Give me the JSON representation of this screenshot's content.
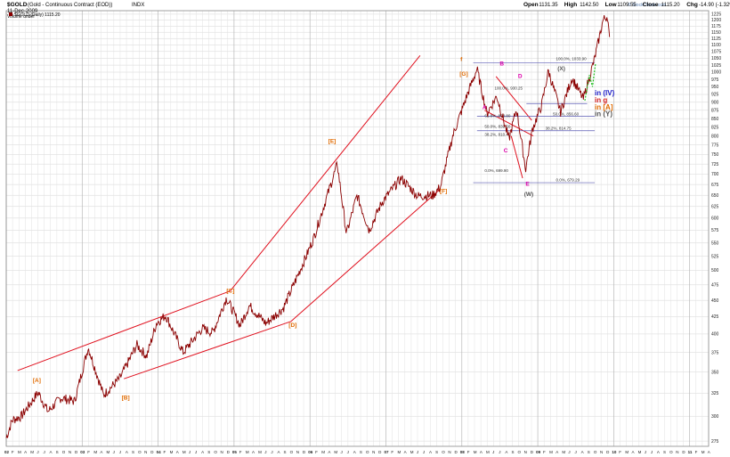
{
  "header": {
    "symbol": "$GOLD",
    "name": "(Gold - Continuous Contract (EOD))",
    "exchange": "INDX",
    "date": "11-Dec-2009",
    "volume": "Volume undef",
    "legend_name": "$GOLD (Daily)",
    "legend_value": "1115.20",
    "watermark": "© StockCharts.com",
    "ohlc": [
      {
        "label": "Open",
        "value": "1131.35"
      },
      {
        "label": "High",
        "value": "1142.50"
      },
      {
        "label": "Low",
        "value": "1109.55"
      },
      {
        "label": "Close",
        "value": "1115.20"
      },
      {
        "label": "Chg",
        "value": "-14.90 (-1.32%)"
      }
    ]
  },
  "chart_data": {
    "type": "line",
    "title": "$GOLD (Daily) 1115.20",
    "y_scale": "log",
    "ylim": [
      270,
      1240
    ],
    "xlim": [
      "2002-01",
      "2011-03"
    ],
    "grid": true,
    "y_ticks": [
      275,
      300,
      325,
      350,
      375,
      400,
      425,
      450,
      475,
      500,
      525,
      550,
      575,
      600,
      625,
      650,
      675,
      700,
      725,
      750,
      775,
      800,
      825,
      850,
      875,
      900,
      925,
      950,
      975,
      1000,
      1025,
      1050,
      1075,
      1100,
      1125,
      1150,
      1175,
      1200,
      1225
    ],
    "x_years": [
      {
        "label": "02",
        "t": 2002.0
      },
      {
        "label": "03",
        "t": 2003.0
      },
      {
        "label": "04",
        "t": 2004.0
      },
      {
        "label": "05",
        "t": 2005.0
      },
      {
        "label": "06",
        "t": 2006.0
      },
      {
        "label": "07",
        "t": 2007.0
      },
      {
        "label": "08",
        "t": 2008.0
      },
      {
        "label": "09",
        "t": 2009.0
      },
      {
        "label": "10",
        "t": 2010.0
      },
      {
        "label": "11",
        "t": 2011.0
      }
    ],
    "x_month_letters": [
      "J",
      "F",
      "M",
      "A",
      "M",
      "J",
      "J",
      "A",
      "S",
      "O",
      "N",
      "D"
    ],
    "series": [
      {
        "color": "#8b0000",
        "points": [
          [
            2002.0,
            278
          ],
          [
            2002.08,
            296
          ],
          [
            2002.2,
            300
          ],
          [
            2002.42,
            326
          ],
          [
            2002.55,
            305
          ],
          [
            2002.72,
            320
          ],
          [
            2002.9,
            316
          ],
          [
            2003.08,
            382
          ],
          [
            2003.28,
            323
          ],
          [
            2003.5,
            343
          ],
          [
            2003.72,
            385
          ],
          [
            2003.85,
            370
          ],
          [
            2003.98,
            416
          ],
          [
            2004.1,
            427
          ],
          [
            2004.33,
            375
          ],
          [
            2004.58,
            408
          ],
          [
            2004.72,
            402
          ],
          [
            2004.9,
            454
          ],
          [
            2005.08,
            412
          ],
          [
            2005.2,
            442
          ],
          [
            2005.42,
            415
          ],
          [
            2005.65,
            438
          ],
          [
            2005.95,
            525
          ],
          [
            2006.05,
            560
          ],
          [
            2006.36,
            725
          ],
          [
            2006.48,
            568
          ],
          [
            2006.62,
            650
          ],
          [
            2006.78,
            575
          ],
          [
            2006.95,
            635
          ],
          [
            2007.2,
            690
          ],
          [
            2007.42,
            648
          ],
          [
            2007.62,
            650
          ],
          [
            2007.72,
            670
          ],
          [
            2007.88,
            800
          ],
          [
            2008.08,
            930
          ],
          [
            2008.2,
            1011
          ],
          [
            2008.33,
            865
          ],
          [
            2008.46,
            920
          ],
          [
            2008.62,
            790
          ],
          [
            2008.72,
            880
          ],
          [
            2008.84,
            712
          ],
          [
            2008.93,
            820
          ],
          [
            2009.05,
            890
          ],
          [
            2009.14,
            1005
          ],
          [
            2009.3,
            870
          ],
          [
            2009.45,
            980
          ],
          [
            2009.6,
            910
          ],
          [
            2009.75,
            1050
          ],
          [
            2009.86,
            1200
          ],
          [
            2009.92,
            1218
          ],
          [
            2009.945,
            1115
          ]
        ]
      }
    ],
    "annotations": [
      {
        "text": "[A]",
        "color": "#e06a00",
        "t": 2002.35,
        "v": 338
      },
      {
        "text": "[B]",
        "color": "#e06a00",
        "t": 2003.52,
        "v": 318
      },
      {
        "text": "[C]",
        "color": "#e06a00",
        "t": 2004.9,
        "v": 462
      },
      {
        "text": "[D]",
        "color": "#e06a00",
        "t": 2005.72,
        "v": 410
      },
      {
        "text": "[E]",
        "color": "#e06a00",
        "t": 2006.24,
        "v": 780
      },
      {
        "text": "[F]",
        "color": "#e06a00",
        "t": 2007.71,
        "v": 655
      },
      {
        "text": "f",
        "color": "#e06a00",
        "t": 2007.98,
        "v": 1040
      },
      {
        "text": "[G]",
        "color": "#e06a00",
        "t": 2007.97,
        "v": 988
      },
      {
        "text": "A",
        "color": "#dd00aa",
        "t": 2008.27,
        "v": 878
      },
      {
        "text": "B",
        "color": "#dd00aa",
        "t": 2008.5,
        "v": 1023
      },
      {
        "text": "C",
        "color": "#dd00aa",
        "t": 2008.55,
        "v": 755
      },
      {
        "text": "D",
        "color": "#dd00aa",
        "t": 2008.74,
        "v": 980
      },
      {
        "text": "E",
        "color": "#dd00aa",
        "t": 2008.84,
        "v": 672
      },
      {
        "text": "(W)",
        "color": "#555555",
        "t": 2008.82,
        "v": 648
      },
      {
        "text": "(X)",
        "color": "#555555",
        "t": 2009.26,
        "v": 1007
      },
      {
        "text": "in (IV)",
        "color": "#1e1ec8",
        "t": 2009.75,
        "v": 922
      },
      {
        "text": "in g",
        "color": "#d21e1e",
        "t": 2009.75,
        "v": 900
      },
      {
        "text": "in [A]",
        "color": "#e06a00",
        "t": 2009.75,
        "v": 877
      },
      {
        "text": "in (Y)",
        "color": "#555555",
        "t": 2009.75,
        "v": 857
      }
    ],
    "fib_labels": [
      {
        "text": "100.0%, 1033.90",
        "t": 2009.24,
        "v": 1043
      },
      {
        "text": "0.0%, 679.29",
        "t": 2009.24,
        "v": 683
      },
      {
        "text": "38.2%, 814.75",
        "t": 2009.1,
        "v": 818
      },
      {
        "text": "50.0%, 856.60",
        "t": 2009.2,
        "v": 860
      },
      {
        "text": "100.0%, 930.25",
        "t": 2008.43,
        "v": 941
      },
      {
        "text": "61.8%, 868.80",
        "t": 2008.3,
        "v": 855
      },
      {
        "text": "50.0%, 839.60",
        "t": 2008.3,
        "v": 823
      },
      {
        "text": "38.2%, 810.40",
        "t": 2008.3,
        "v": 800
      },
      {
        "text": "0.0%, 699.90",
        "t": 2008.3,
        "v": 705
      }
    ]
  }
}
